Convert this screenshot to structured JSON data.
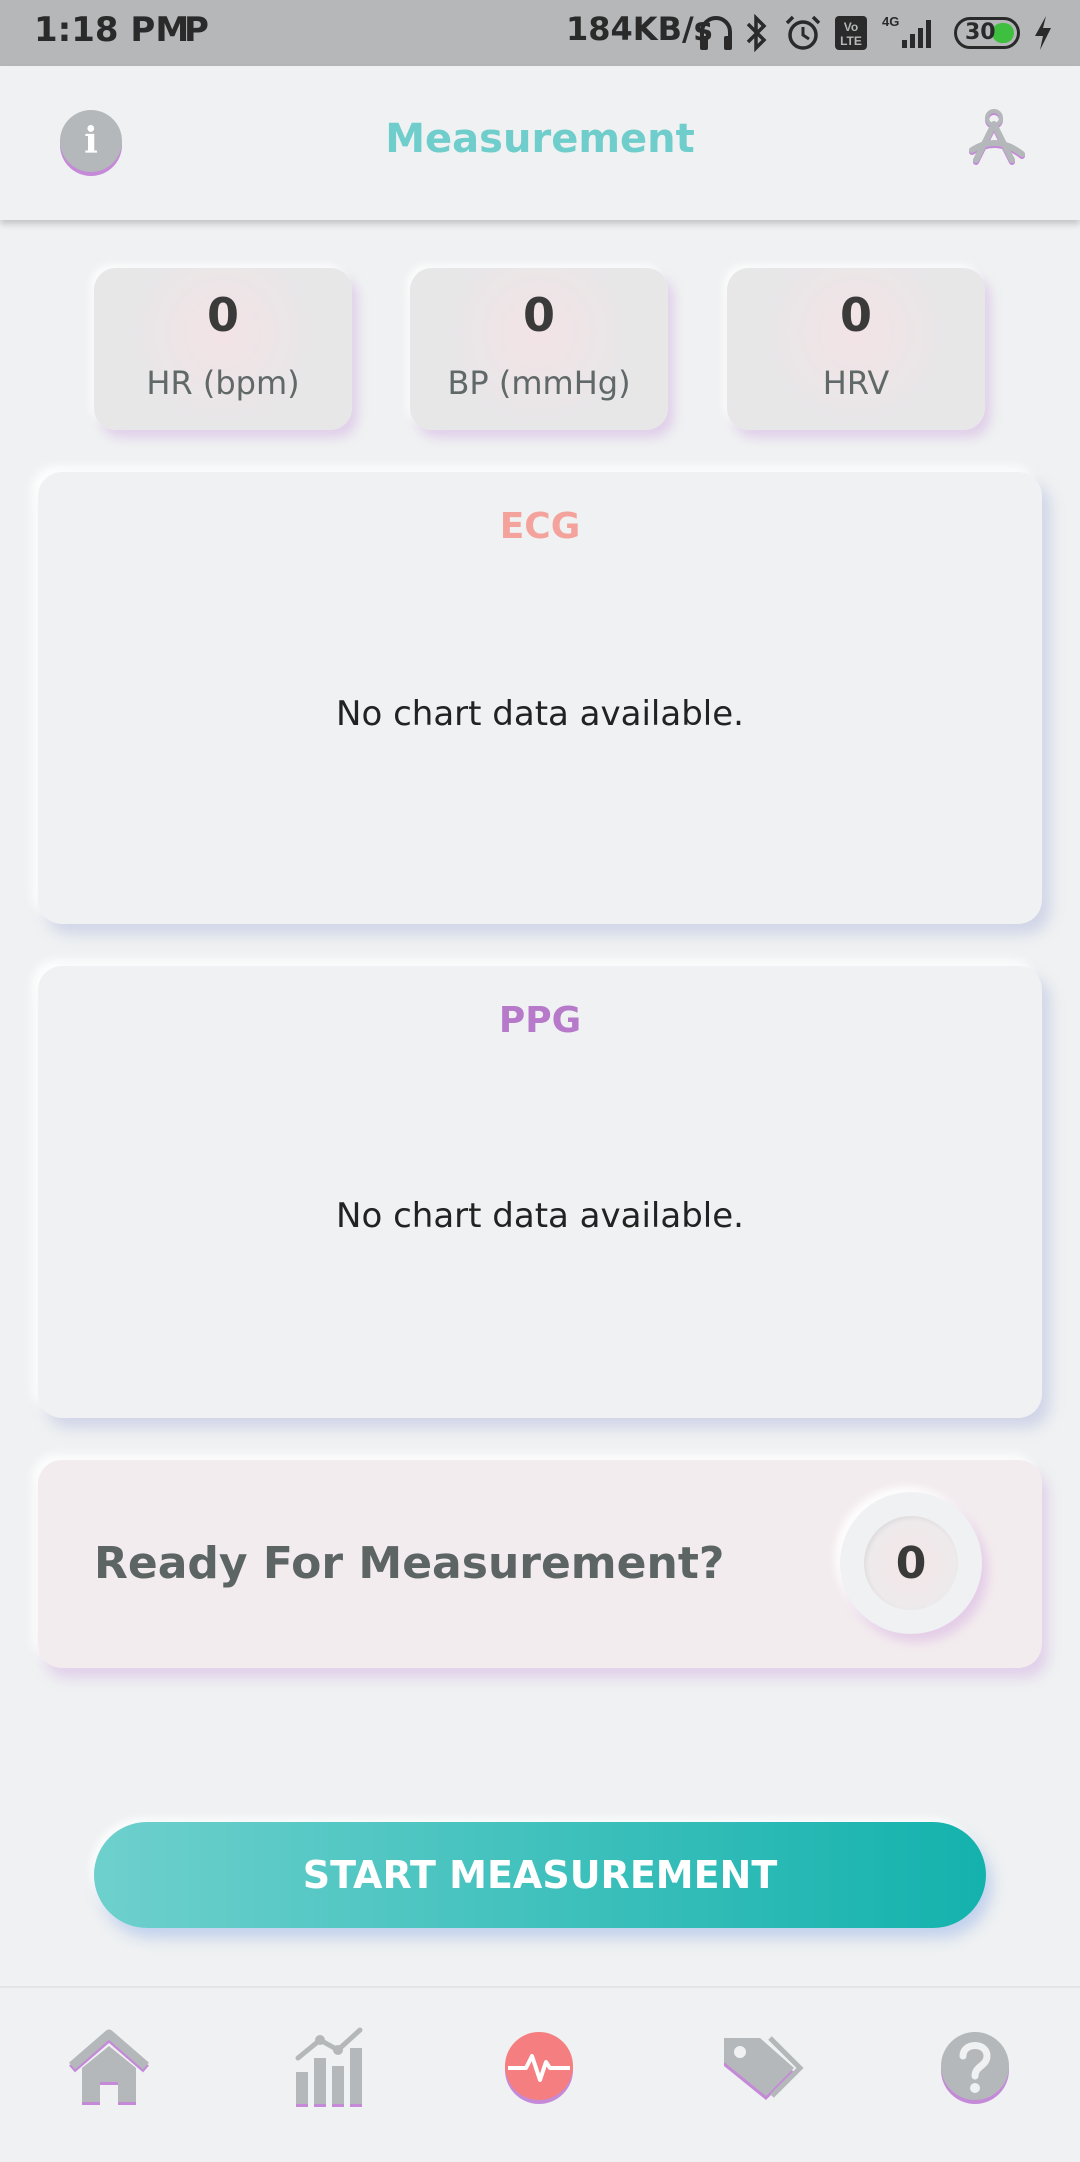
{
  "status_bar": {
    "time": "1:18 PM",
    "carrier_icon": "P",
    "network_speed": "184KB/s",
    "battery_level": "30",
    "icons": [
      "headphones-icon",
      "bluetooth-icon",
      "alarm-icon",
      "volte-icon",
      "signal-icon",
      "battery-icon",
      "charging-icon"
    ]
  },
  "header": {
    "title": "Measurement",
    "left_icon": "info-icon",
    "right_icon": "profile-icon"
  },
  "stats": [
    {
      "value": "0",
      "label": "HR (bpm)"
    },
    {
      "value": "0",
      "label": "BP (mmHg)"
    },
    {
      "value": "0",
      "label": "HRV"
    }
  ],
  "charts": {
    "ecg": {
      "title": "ECG",
      "empty_text": "No chart data available.",
      "color": "#f3a39c"
    },
    "ppg": {
      "title": "PPG",
      "empty_text": "No chart data available.",
      "color": "#b779c9"
    }
  },
  "ready": {
    "text": "Ready For Measurement?",
    "count": "0"
  },
  "start_button": {
    "label": "START MEASUREMENT"
  },
  "bottom_nav": [
    {
      "icon": "home-icon"
    },
    {
      "icon": "statistics-icon"
    },
    {
      "icon": "heartbeat-icon",
      "active": true
    },
    {
      "icon": "tag-icon"
    },
    {
      "icon": "help-icon"
    }
  ],
  "colors": {
    "accent": "#6fcdcb",
    "button_gradient_start": "#6ed0cd",
    "button_gradient_end": "#14b2ad",
    "active_nav": "#f57f80",
    "nav_grey": "#b4b8ba",
    "nav_shadow": "#c48ad8"
  }
}
